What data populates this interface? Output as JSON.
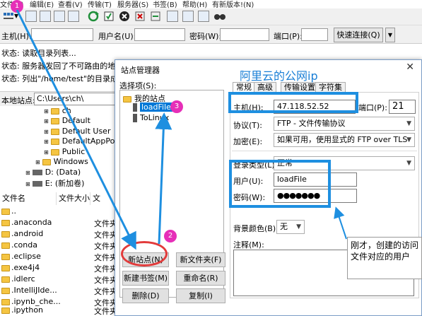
{
  "menu": {
    "items": [
      "文件(F)",
      "编辑(E)",
      "查看(V)",
      "传输(T)",
      "服务器(S)",
      "书签(B)",
      "帮助(H)",
      "有新版本!(N)"
    ]
  },
  "quickconnect": {
    "host_label": "主机(H):",
    "user_label": "用户名(U):",
    "pass_label": "密码(W):",
    "port_label": "端口(P):",
    "connect_button": "快速连接(Q)",
    "dropdown_icon": "▼"
  },
  "log": {
    "lines": [
      "状态:  读取目录列表...",
      "状态:  服务器发回了不可路由的地址。使",
      "状态:  列出\"/home/test\"的目录成功"
    ]
  },
  "local": {
    "site_label": "本地站点:",
    "path": "C:\\Users\\ch\\",
    "tree": [
      {
        "label": "ch",
        "indent": 0
      },
      {
        "label": "Default",
        "indent": 0
      },
      {
        "label": "Default User",
        "indent": 0
      },
      {
        "label": "DefaultAppPool",
        "indent": 0
      },
      {
        "label": "Public",
        "indent": 0
      },
      {
        "label": "Windows",
        "indent": 1
      },
      {
        "label": "D: (Data)",
        "indent": 2
      },
      {
        "label": "E: (新加卷)",
        "indent": 2
      }
    ],
    "columns": {
      "name": "文件名",
      "size": "文件大小",
      "type": "文"
    },
    "files": [
      {
        "name": "..",
        "type": ""
      },
      {
        "name": ".anaconda",
        "type": "文件夹"
      },
      {
        "name": ".android",
        "type": "文件夹"
      },
      {
        "name": ".conda",
        "type": "文件夹"
      },
      {
        "name": ".eclipse",
        "type": "文件夹"
      },
      {
        "name": ".exe4j4",
        "type": "文件夹"
      },
      {
        "name": ".idlerc",
        "type": "文件夹"
      },
      {
        "name": ".IntelliJIde...",
        "type": "文件夹"
      },
      {
        "name": ".ipynb_che...",
        "type": "文件夹"
      },
      {
        "name": ".ipython",
        "type": "文件夹"
      }
    ]
  },
  "site_manager": {
    "title": "站点管理器",
    "close_icon": "✕",
    "select_label": "选择项(S):",
    "root": "我的站点",
    "sites": [
      "loadFile",
      "ToLinux"
    ],
    "tabs": [
      "常规",
      "高级",
      "传输设置",
      "字符集"
    ],
    "host_label": "主机(H):",
    "host_value": "47.118.52.52",
    "port_label": "端口(P):",
    "port_value": "21",
    "protocol_label": "协议(T):",
    "protocol_value": "FTP - 文件传输协议",
    "encryption_label": "加密(E):",
    "encryption_value": "如果可用，使用显式的 FTP over TLS",
    "logon_label": "登录类型(L):",
    "logon_value": "正常",
    "user_label": "用户(U):",
    "user_value": "loadFile",
    "password_label": "密码(W):",
    "password_value": "●●●●●●●",
    "bgcolor_label": "背景颜色(B)",
    "bgcolor_value": "无",
    "comment_label": "注释(M):",
    "buttons": {
      "new_site": "新站点(N)",
      "new_folder": "新文件夹(F)",
      "new_bookmark": "新建书签(M)",
      "rename": "重命名(R)",
      "delete": "删除(D)",
      "copy": "复制(I)"
    }
  },
  "annotations": {
    "ip_title": "阿里云的公网ip",
    "note": "刚才，创建的访问文件对应的用户",
    "marker1": "1",
    "marker2": "2",
    "marker3": "3"
  },
  "colors": {
    "highlight": "#1e8fe0",
    "marker": "#e62fb8",
    "annotation_text": "#1a7fd6"
  }
}
